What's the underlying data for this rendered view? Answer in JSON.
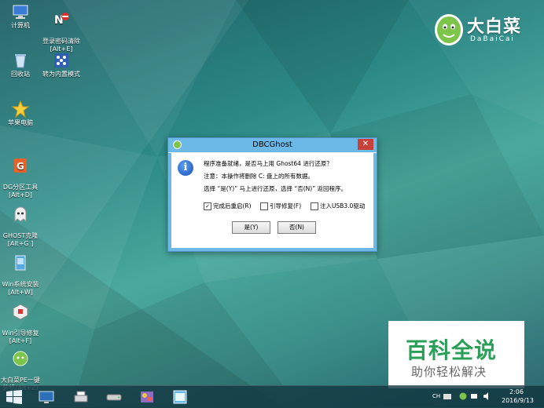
{
  "desktop": {
    "icons": [
      {
        "label": "计算机"
      },
      {
        "label": "登录密码清除\n[Alt+E]"
      },
      {
        "label": "回收站"
      },
      {
        "label": "转为内置模式"
      },
      {
        "label": "苹果电脑"
      },
      {
        "label": "DG分区工具\n[Alt+D]"
      },
      {
        "label": "GHOST克隆\n[Alt+G ]"
      },
      {
        "label": "Win系统安装\n[Alt+W]"
      },
      {
        "label": "Win引导修复\n[Alt+F]"
      },
      {
        "label": "大白菜PE一键\n装机(Alt+Z)"
      }
    ]
  },
  "brand": {
    "name_cn": "大白菜",
    "name_en": "DaBaiCai"
  },
  "dialog": {
    "title": "DBCGhost",
    "close_label": "✕",
    "message_1": "程序准备就绪，是否马上用 Ghost64 进行还原？",
    "message_2": "注意：本操作将删除 C: 盘上的所有数据。",
    "message_3": "选择 “是(Y)” 马上进行还原，选择 “否(N)” 返回程序。",
    "checkboxes": [
      {
        "label": "完成后重启(R)",
        "checked": true
      },
      {
        "label": "引导修复(F)",
        "checked": false
      },
      {
        "label": "注入USB3.0驱动",
        "checked": false
      }
    ],
    "yes_label": "是(Y)",
    "no_label": "否(N)"
  },
  "watermark": {
    "title": "百科全说",
    "subtitle": "助你轻松解决"
  },
  "taskbar": {
    "tray_lang": "CH",
    "time": "2:06",
    "date": "2016/9/13"
  },
  "colors": {
    "accent": "#6cb8e6",
    "close": "#c7413a",
    "watermark_green": "#2a9f57"
  }
}
